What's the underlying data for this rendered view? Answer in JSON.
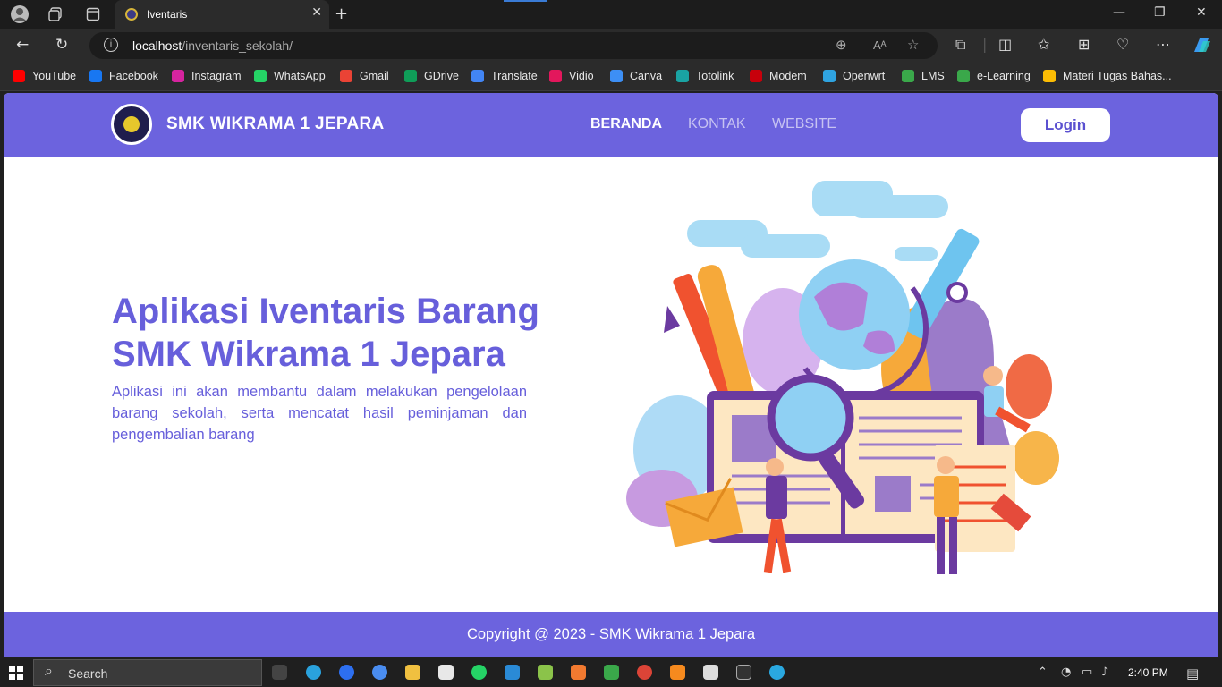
{
  "browser": {
    "tab_title": "Iventaris",
    "url_host": "localhost",
    "url_path": "/inventaris_sekolah/",
    "bookmarks": [
      {
        "label": "YouTube",
        "color": "#ff0000"
      },
      {
        "label": "Facebook",
        "color": "#1877f2"
      },
      {
        "label": "Instagram",
        "color": "#d6249f"
      },
      {
        "label": "WhatsApp",
        "color": "#25d366"
      },
      {
        "label": "Gmail",
        "color": "#ea4335"
      },
      {
        "label": "GDrive",
        "color": "#0f9d58"
      },
      {
        "label": "Translate",
        "color": "#4285f4"
      },
      {
        "label": "Vidio",
        "color": "#e3175c"
      },
      {
        "label": "Canva",
        "color": "#3d8ff5"
      },
      {
        "label": "Totolink",
        "color": "#1aa3a3"
      },
      {
        "label": "Modem",
        "color": "#c7000b"
      },
      {
        "label": "Openwrt",
        "color": "#2fa3e0"
      },
      {
        "label": "LMS",
        "color": "#3aa84a"
      },
      {
        "label": "e-Learning",
        "color": "#3aa84a"
      },
      {
        "label": "Materi Tugas Bahas...",
        "color": "#fbbc04"
      }
    ]
  },
  "site": {
    "brand": "SMK WIKRAMA 1 JEPARA",
    "nav": [
      "BERANDA",
      "KONTAK",
      "WEBSITE"
    ],
    "login_label": "Login",
    "hero_title_line1": "Aplikasi Iventaris Barang",
    "hero_title_line2": "SMK Wikrama 1 Jepara",
    "hero_description": "Aplikasi ini akan membantu dalam melakukan pengelolaan barang sekolah, serta mencatat hasil peminjaman dan pengembalian barang",
    "footer": "Copyright @ 2023 - SMK Wikrama 1 Jepara",
    "accent_color": "#6c63de"
  },
  "taskbar": {
    "search_label": "Search",
    "time": "2:40 PM"
  }
}
